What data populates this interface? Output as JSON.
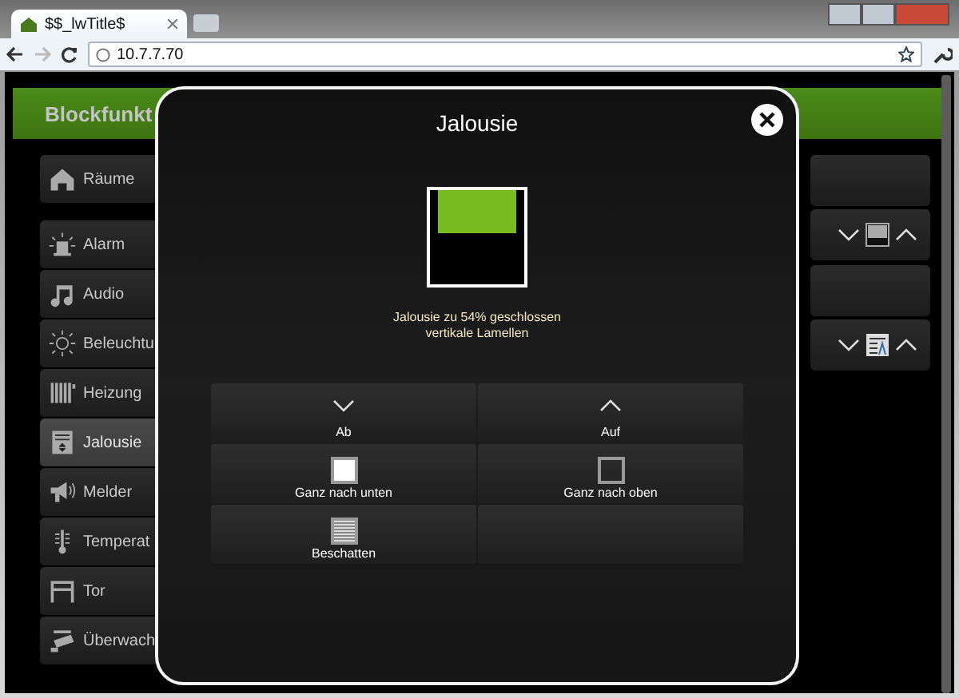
{
  "browser": {
    "tab_title": "$$_lwTitle$",
    "address": "10.7.7.70"
  },
  "header": {
    "title": "Blockfunkt"
  },
  "sidebar": {
    "items": [
      {
        "label": "Räume",
        "kind": "home",
        "selected": false
      },
      {
        "label": "Alarm",
        "kind": "alarm",
        "selected": false
      },
      {
        "label": "Audio",
        "kind": "music",
        "selected": false
      },
      {
        "label": "Beleuchtu",
        "kind": "light",
        "selected": false
      },
      {
        "label": "Heizung",
        "kind": "heater",
        "selected": false
      },
      {
        "label": "Jalousie",
        "kind": "blind",
        "selected": true
      },
      {
        "label": "Melder",
        "kind": "horn",
        "selected": false
      },
      {
        "label": "Temperat",
        "kind": "thermo",
        "selected": false
      },
      {
        "label": "Tor",
        "kind": "gate",
        "selected": false
      },
      {
        "label": "Überwach",
        "kind": "camera",
        "selected": false
      }
    ]
  },
  "right_panels": [
    {
      "kind": "blind"
    },
    {
      "kind": "text"
    }
  ],
  "dialog": {
    "title": "Jalousie",
    "indicator": {
      "level": 0.45
    },
    "status": [
      "Jalousie zu  54% geschlossen",
      "vertikale Lamellen"
    ],
    "buttons": [
      {
        "label": "Ab",
        "kind": "down"
      },
      {
        "label": "Auf",
        "kind": "up"
      },
      {
        "label": "Ganz nach unten",
        "kind": "full"
      },
      {
        "label": "Ganz nach oben",
        "kind": "empty"
      },
      {
        "label": "Beschatten",
        "kind": "shade"
      },
      {
        "kind": "blank"
      }
    ]
  }
}
